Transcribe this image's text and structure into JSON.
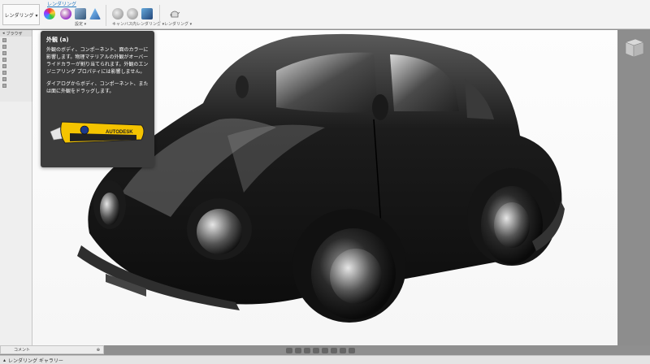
{
  "toolbar": {
    "workspace_label": "レンダリング ▾",
    "tab_label": "レンダリング",
    "setup_label": "設定 ▾",
    "canvas_render_label": "キャンバス内レンダリング ▾",
    "render_label": "レンダリング ▾"
  },
  "browser": {
    "title": "ブラウザ"
  },
  "tooltip": {
    "title": "外観 (a)",
    "body1": "外観のボディ、コンポーネント、面のカラーに影響します。物理マテリアルの外観がオーバーライドカラーが割り当てられます。外観のエンジニアリング プロパティには影響しません。",
    "body2": "ダイアログからボディ、コンポーネント、または面に外観をドラッグします。",
    "brand": "AUTODESK"
  },
  "comment_bar": {
    "label": "コメント"
  },
  "gallery_bar": {
    "label": "レンダリング ギャラリー"
  },
  "colors": {
    "accent": "#2a7bc0",
    "tooltip_bg": "#3c3c3c",
    "car_body": "#1a1a1a"
  }
}
